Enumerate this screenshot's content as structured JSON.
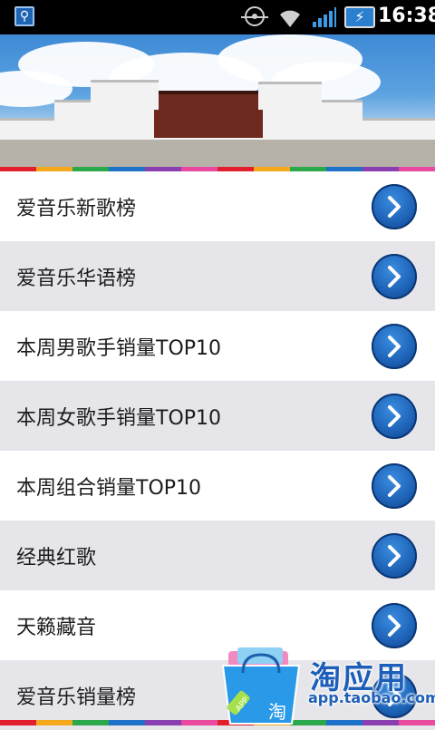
{
  "status_bar": {
    "time": "16:38",
    "icons": [
      "usb-icon",
      "gps-icon",
      "wifi-icon",
      "signal-icon",
      "battery-charging-icon"
    ]
  },
  "banner": {
    "image": "potala-palace-photo"
  },
  "list": {
    "items": [
      {
        "label": "爱音乐新歌榜"
      },
      {
        "label": "爱音乐华语榜"
      },
      {
        "label": "本周男歌手销量TOP10"
      },
      {
        "label": "本周女歌手销量TOP10"
      },
      {
        "label": "本周组合销量TOP10"
      },
      {
        "label": "经典红歌"
      },
      {
        "label": "天籁藏音"
      },
      {
        "label": "爱音乐销量榜"
      }
    ]
  },
  "overlay_badge": {
    "title": "淘应用",
    "url": "app.taobao.com",
    "bag_text": "APP",
    "bag_glyph": "淘"
  },
  "colors": {
    "row_alt": "#e6e5ea",
    "row_white": "#ffffff",
    "arrow_button": "#1e64b8",
    "badge_text": "#1d5fb8"
  }
}
